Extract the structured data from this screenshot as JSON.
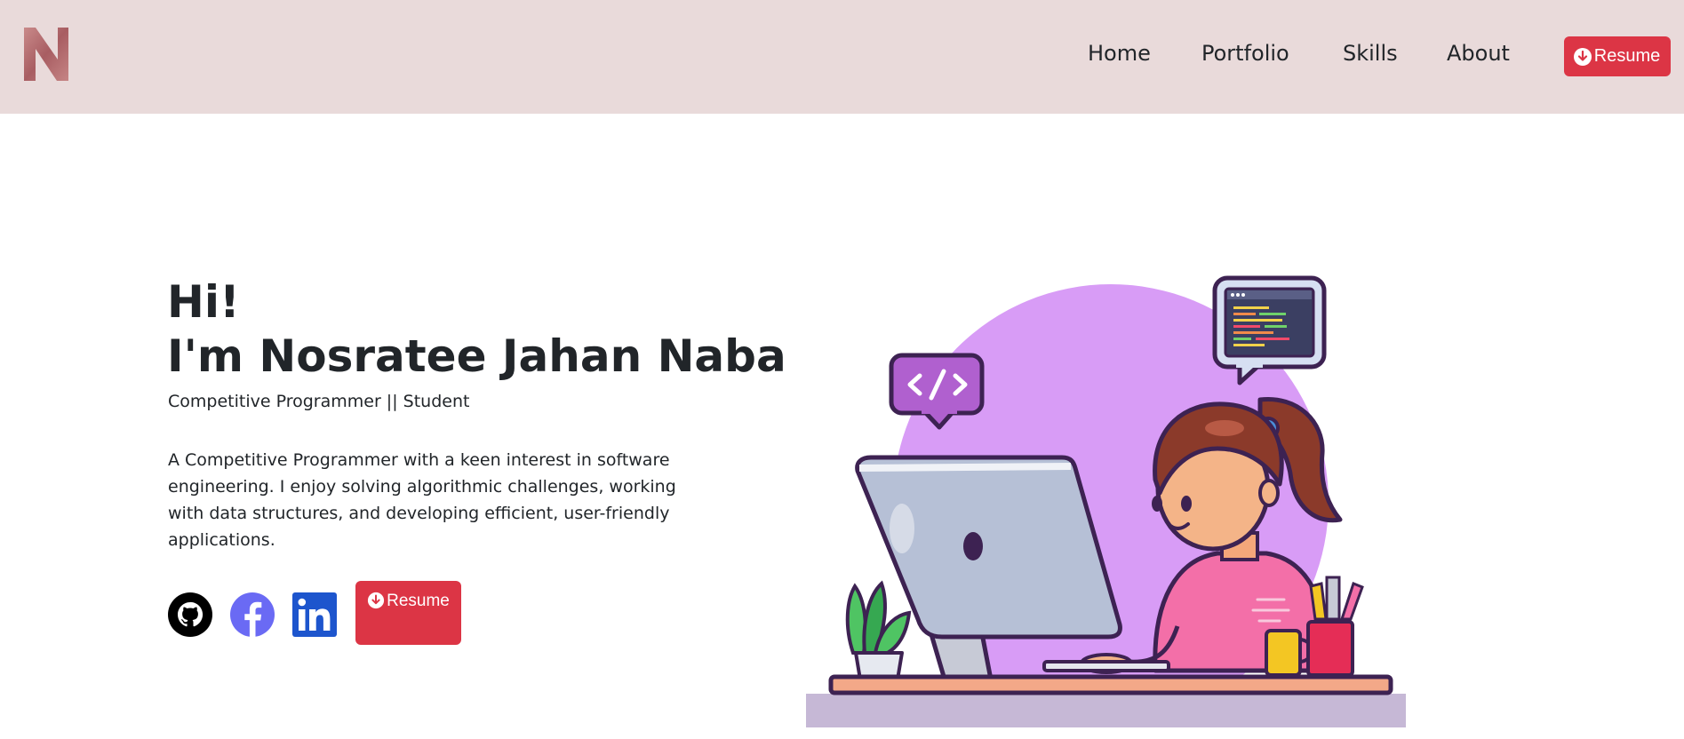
{
  "nav": {
    "logo_letter": "N",
    "links": [
      {
        "label": "Home"
      },
      {
        "label": "Portfolio"
      },
      {
        "label": "Skills"
      },
      {
        "label": "About"
      }
    ],
    "resume_label": "Resume"
  },
  "hero": {
    "greeting": "Hi!",
    "name_line": "I'm Nosratee Jahan Naba",
    "subtitle": "Competitive Programmer || Student",
    "description": "A Competitive Programmer with a keen interest in software engineering. I enjoy solving algorithmic challenges, working with data structures, and developing efficient, user-friendly applications.",
    "resume_label": "Resume",
    "socials": [
      {
        "icon": "github-icon"
      },
      {
        "icon": "facebook-icon"
      },
      {
        "icon": "linkedin-icon"
      }
    ],
    "illustration_icon": "girl-coding-illustration"
  },
  "colors": {
    "navbar_bg": "#e9dada",
    "accent_red": "#dc3545",
    "text_dark": "#212529",
    "facebook_blue": "#6a6af4",
    "linkedin_blue": "#1d55cd",
    "purple_circle": "#d89cf6"
  }
}
